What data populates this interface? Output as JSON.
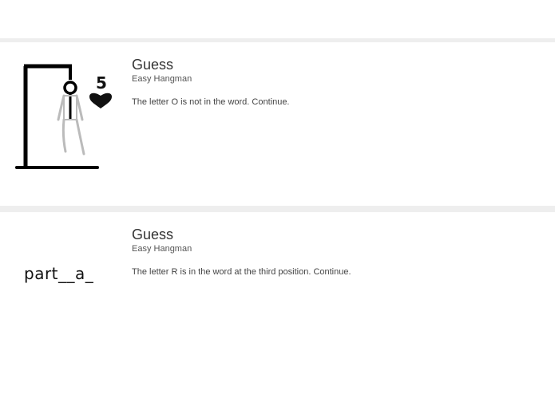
{
  "cards": [
    {
      "title": "Guess",
      "subtitle": "Easy Hangman",
      "message": "The letter O is not in the word. Continue.",
      "lives": "5",
      "image": "hangman-drawing"
    },
    {
      "title": "Guess",
      "subtitle": "Easy Hangman",
      "message": "The letter R is in the word at the third position. Continue.",
      "word_progress": "part__a_"
    }
  ],
  "colors": {
    "divider": "#eeeeee",
    "text": "#333333",
    "figure_body": "#cccccc"
  }
}
